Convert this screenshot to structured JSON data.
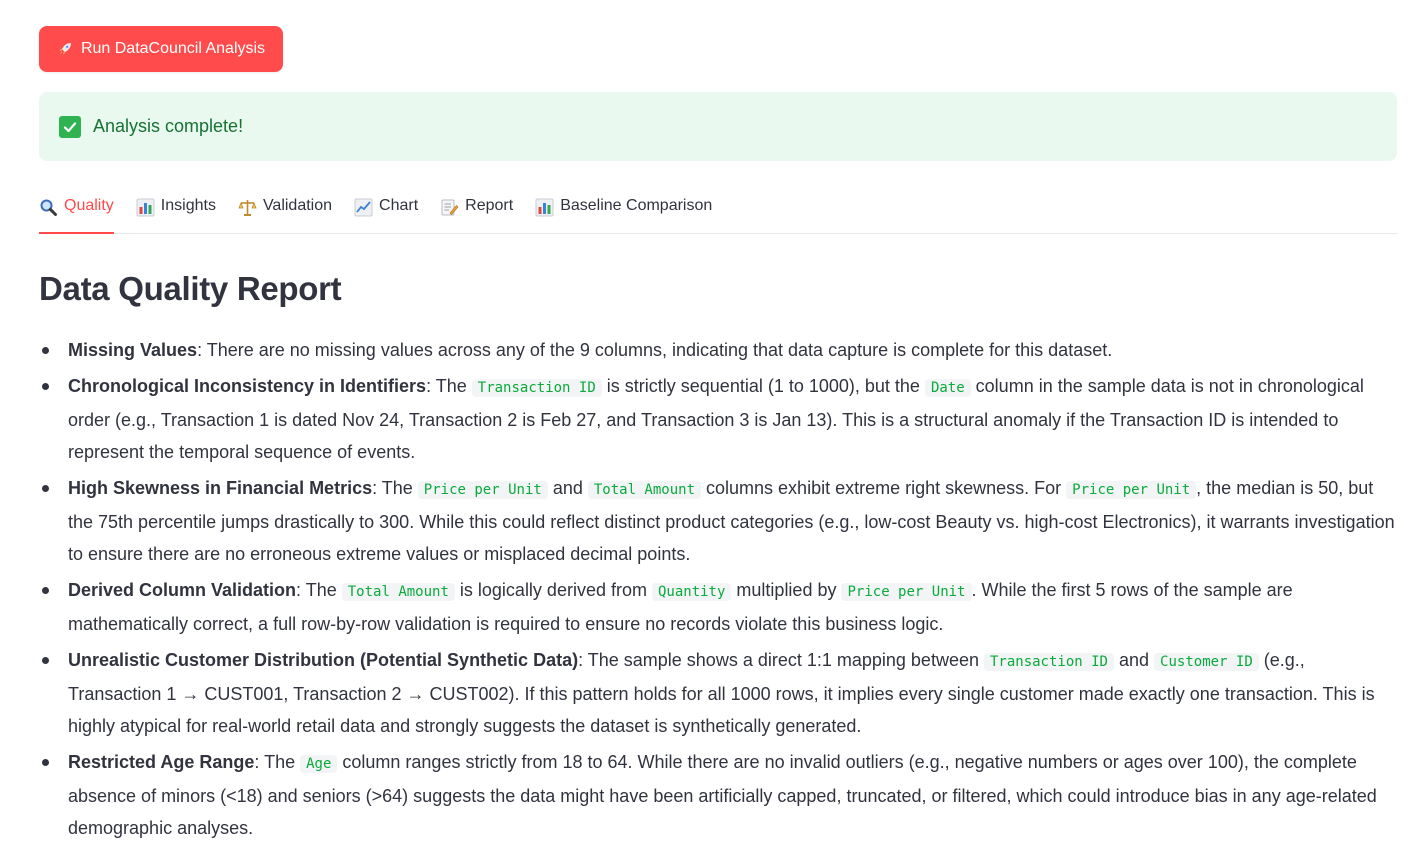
{
  "run_button": {
    "label": "Run DataCouncil Analysis",
    "icon": "rocket-icon"
  },
  "status": {
    "text": "Analysis complete!",
    "icon": "check-mark-icon",
    "color": "#177233"
  },
  "tabs": [
    {
      "label": "Quality",
      "icon": "magnifier-icon",
      "active": true
    },
    {
      "label": "Insights",
      "icon": "bar-chart-icon",
      "active": false
    },
    {
      "label": "Validation",
      "icon": "balance-scale-icon",
      "active": false
    },
    {
      "label": "Chart",
      "icon": "line-chart-icon",
      "active": false
    },
    {
      "label": "Report",
      "icon": "memo-icon",
      "active": false
    },
    {
      "label": "Baseline Comparison",
      "icon": "bar-chart-icon",
      "active": false
    }
  ],
  "colors": {
    "accent": "#ff4b4b",
    "success_bg": "#e9f9ef",
    "code": "#09ab3b"
  },
  "report": {
    "title": "Data Quality Report",
    "items": [
      {
        "title": "Missing Values",
        "t1": ": There are no missing values across any of the 9 columns, indicating that data capture is complete for this dataset."
      },
      {
        "title": "Chronological Inconsistency in Identifiers",
        "t1": ": The ",
        "c1": "Transaction ID",
        "t2": " is strictly sequential (1 to 1000), but the ",
        "c2": "Date",
        "t3": " column in the sample data is not in chronological order (e.g., Transaction 1 is dated Nov 24, Transaction 2 is Feb 27, and Transaction 3 is Jan 13). This is a structural anomaly if the Transaction ID is intended to represent the temporal sequence of events."
      },
      {
        "title": "High Skewness in Financial Metrics",
        "t1": ": The ",
        "c1": "Price per Unit",
        "t2": " and ",
        "c2": "Total Amount",
        "t3": " columns exhibit extreme right skewness. For ",
        "c3": "Price per Unit",
        "t4": ", the median is 50, but the 75th percentile jumps drastically to 300. While this could reflect distinct product categories (e.g., low-cost Beauty vs. high-cost Electronics), it warrants investigation to ensure there are no erroneous extreme values or misplaced decimal points."
      },
      {
        "title": "Derived Column Validation",
        "t1": ": The ",
        "c1": "Total Amount",
        "t2": " is logically derived from ",
        "c2": "Quantity",
        "t3": " multiplied by ",
        "c3": "Price per Unit",
        "t4": ". While the first 5 rows of the sample are mathematically correct, a full row-by-row validation is required to ensure no records violate this business logic."
      },
      {
        "title": "Unrealistic Customer Distribution (Potential Synthetic Data)",
        "t1": ": The sample shows a direct 1:1 mapping between ",
        "c1": "Transaction ID",
        "t2": " and ",
        "c2": "Customer ID",
        "t3": " (e.g., Transaction 1 → CUST001, Transaction 2 → CUST002). If this pattern holds for all 1000 rows, it implies every single customer made exactly one transaction. This is highly atypical for real-world retail data and strongly suggests the dataset is synthetically generated."
      },
      {
        "title": "Restricted Age Range",
        "t1": ": The ",
        "c1": "Age",
        "t2": " column ranges strictly from 18 to 64. While there are no invalid outliers (e.g., negative numbers or ages over 100), the complete absence of minors (<18) and seniors (>64) suggests the data might have been artificially capped, truncated, or filtered, which could introduce bias in any age-related demographic analyses."
      }
    ]
  }
}
